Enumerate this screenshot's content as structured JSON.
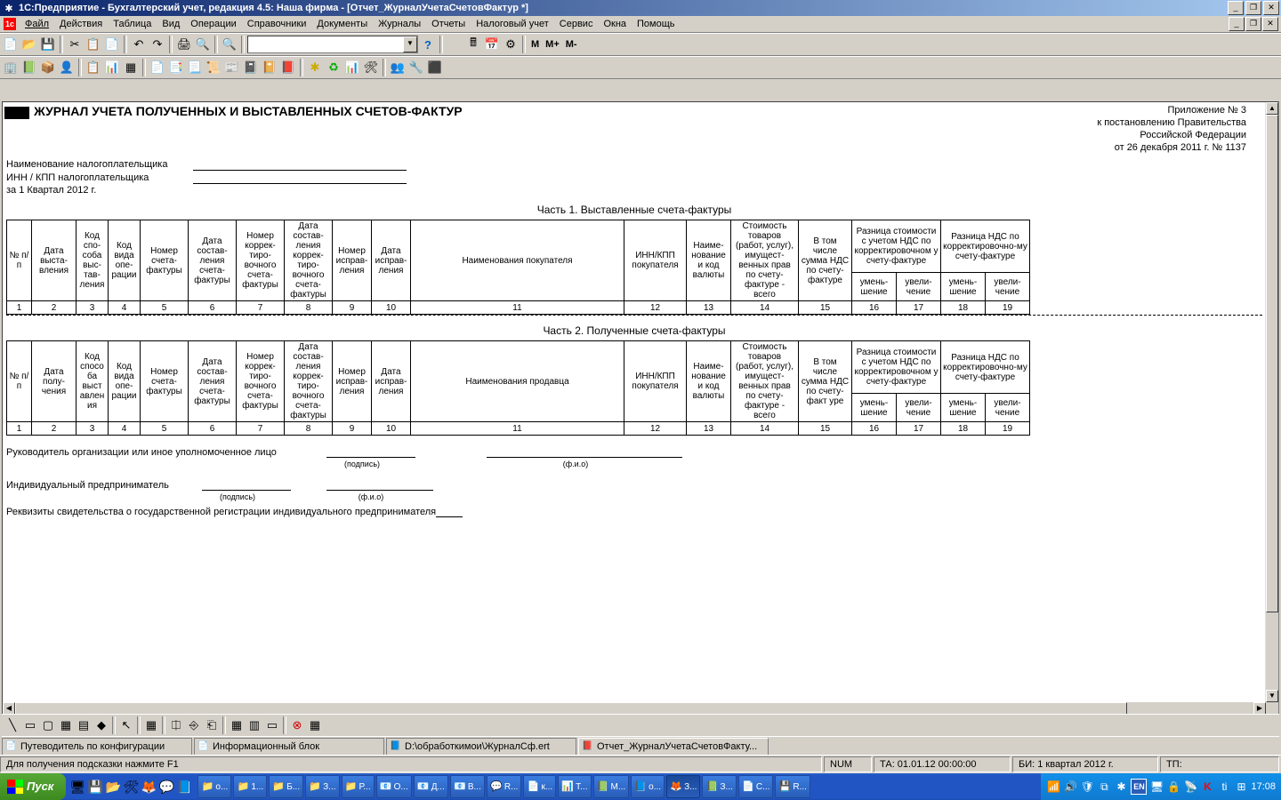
{
  "title": "1С:Предприятие - Бухгалтерский учет, редакция 4.5: Наша фирма - [Отчет_ЖурналУчетаСчетовФактур *]",
  "menu": [
    "Файл",
    "Действия",
    "Таблица",
    "Вид",
    "Операции",
    "Справочники",
    "Документы",
    "Журналы",
    "Отчеты",
    "Налоговый учет",
    "Сервис",
    "Окна",
    "Помощь"
  ],
  "m_labels": {
    "m": "М",
    "mp": "М+",
    "mm": "М-"
  },
  "report": {
    "title": "ЖУРНАЛ УЧЕТА ПОЛУЧЕННЫХ И ВЫСТАВЛЕННЫХ СЧЕТОВ-ФАКТУР",
    "appendix": {
      "l1": "Приложение № 3",
      "l2": "к постановлению Правительства",
      "l3": "Российской Федерации",
      "l4": "от 26 декабря 2011 г. № 1137"
    },
    "taxpayer": {
      "name_label": "Наименование налогоплательщика",
      "inn_label": "ИНН / КПП налогоплательщика",
      "period": "за 1 Квартал 2012 г."
    },
    "part1_title": "Часть 1. Выставленные счета-фактуры",
    "part2_title": "Часть 2. Полученные счета-фактуры",
    "cols1": {
      "c1": "№ п/п",
      "c2": "Дата выста-вления",
      "c3": "Код спо-соба выс-тав-ления",
      "c4": "Код вида опе-рации",
      "c5": "Номер счета-фактуры",
      "c6": "Дата состав-ления счета-фактуры",
      "c7": "Номер коррек-тиро-вочного счета-фактуры",
      "c8": "Дата состав-ления коррек-тиро-вочного счета-фактуры",
      "c9": "Номер исправ-ления",
      "c10": "Дата исправ-ления",
      "c11": "Наименования покупателя",
      "c12": "ИНН/КПП покупателя",
      "c13": "Наиме-нование и код валюты",
      "c14": "Стоимость товаров (работ, услуг), имущест-венных прав по счету-фактуре - всего",
      "c15": "В том числе сумма НДС по счету-фактуре",
      "c16": "Разница стоимости с учетом НДС по корректировочном у счету-фактуре",
      "c17": "Разница НДС по корректировочно-му счету-фактуре",
      "s1": "умень-шение",
      "s2": "увели-чение"
    },
    "cols2": {
      "c2": "Дата полу-чения",
      "c3": "Код спосо ба выст авлен ия",
      "c11": "Наименования продавца",
      "c15": "В том числе сумма НДС по счету-факт уре"
    },
    "nums": [
      "1",
      "2",
      "3",
      "4",
      "5",
      "6",
      "7",
      "8",
      "9",
      "10",
      "11",
      "12",
      "13",
      "14",
      "15",
      "16",
      "17",
      "18",
      "19"
    ],
    "sig": {
      "head": "Руководитель организации или иное уполномоченное лицо",
      "ip": "Индивидуальный предприниматель",
      "reg": "Реквизиты свидетельства о государственной регистрации индивидуального предпринимателя",
      "sign": "(подпись)",
      "fio": "(ф.и.о)"
    }
  },
  "tabs": [
    {
      "icon": "📄",
      "label": "Путеводитель по конфигурации"
    },
    {
      "icon": "📄",
      "label": "Информационный блок"
    },
    {
      "icon": "📘",
      "label": "D:\\обработкимои\\ЖурналСф.ert"
    },
    {
      "icon": "📕",
      "label": "Отчет_ЖурналУчетаСчетовФакту...",
      "active": true
    }
  ],
  "status": {
    "hint": "Для получения подсказки нажмите F1",
    "num": "NUM",
    "ta": "ТА: 01.01.12  00:00:00",
    "bi": "БИ: 1 квартал 2012 г.",
    "tp": "ТП:"
  },
  "taskbar": {
    "start": "Пуск",
    "tasks": [
      {
        "i": "📁",
        "t": "о..."
      },
      {
        "i": "📁",
        "t": "1..."
      },
      {
        "i": "📁",
        "t": "Б..."
      },
      {
        "i": "📁",
        "t": "З..."
      },
      {
        "i": "📁",
        "t": "Р..."
      },
      {
        "i": "📧",
        "t": "O..."
      },
      {
        "i": "📧",
        "t": "Д..."
      },
      {
        "i": "📧",
        "t": "В..."
      },
      {
        "i": "💬",
        "t": "R..."
      },
      {
        "i": "📄",
        "t": "к..."
      },
      {
        "i": "📊",
        "t": "T..."
      },
      {
        "i": "📗",
        "t": "M..."
      },
      {
        "i": "📘",
        "t": "о..."
      },
      {
        "i": "🦊",
        "t": "З...",
        "active": true
      },
      {
        "i": "📗",
        "t": "З..."
      },
      {
        "i": "📄",
        "t": "C..."
      },
      {
        "i": "💾",
        "t": "R..."
      }
    ],
    "tray": {
      "lang": "EN",
      "time": "17:08"
    }
  }
}
